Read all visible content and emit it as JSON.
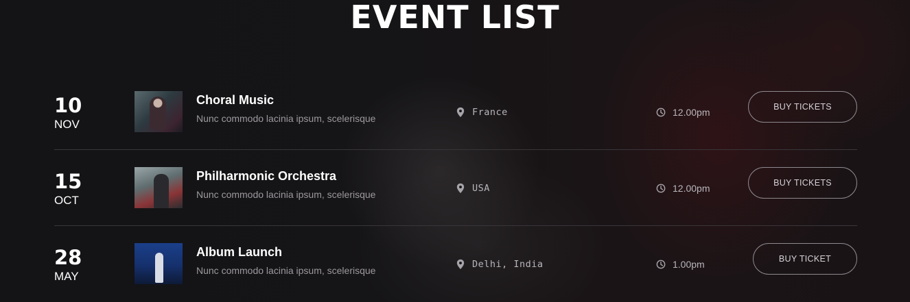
{
  "page": {
    "title": "EVENT LIST"
  },
  "events": [
    {
      "day": "10",
      "month": "NOV",
      "title": "Choral Music",
      "description": "Nunc commodo lacinia ipsum, scelerisque",
      "location": "France",
      "time": "12.00pm",
      "button_label": "BUY TICKETS",
      "location_icon": "map-marker-icon",
      "time_icon": "clock-icon"
    },
    {
      "day": "15",
      "month": "OCT",
      "title": "Philharmonic Orchestra",
      "description": "Nunc commodo lacinia ipsum, scelerisque",
      "location": "USA",
      "time": "12.00pm",
      "button_label": "BUY TICKETS",
      "location_icon": "map-marker-icon",
      "time_icon": "clock-icon"
    },
    {
      "day": "28",
      "month": "MAY",
      "title": "Album Launch",
      "description": "Nunc commodo lacinia ipsum, scelerisque",
      "location": "Delhi, India",
      "time": "1.00pm",
      "button_label": "BUY TICKET",
      "location_icon": "map-marker-icon",
      "time_icon": "clock-icon"
    }
  ],
  "colors": {
    "background": "#151416",
    "text": "#ffffff",
    "muted_text": "#9d9a9f",
    "divider": "#38363a",
    "button_border": "#8d8a8f"
  }
}
